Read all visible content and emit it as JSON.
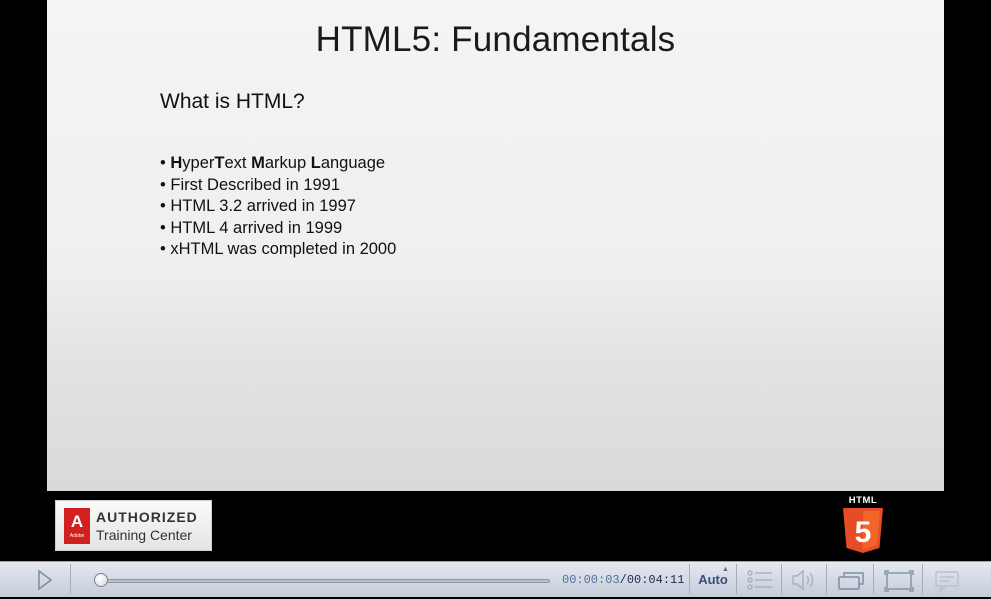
{
  "slide": {
    "title": "HTML5: Fundamentals",
    "subtitle": "What is HTML?",
    "bullets": [
      {
        "b1": "H",
        "t1": "yper",
        "b2": "T",
        "t2": "ext ",
        "b3": "M",
        "t3": "arkup ",
        "b4": "L",
        "t4": "anguage"
      },
      {
        "text": "First Described in 1991"
      },
      {
        "text": "HTML 3.2 arrived in 1997"
      },
      {
        "text": "HTML 4 arrived in 1999"
      },
      {
        "text": "xHTML was completed in 2000"
      }
    ],
    "bullet_char": "•"
  },
  "badge": {
    "logo_letter": "A",
    "logo_small": "Adobe",
    "line1": "AUTHORIZED",
    "line2": "Training Center",
    "accent": "#d21f1f"
  },
  "html5_badge": {
    "label": "HTML",
    "number": "5",
    "accent": "#e44d26"
  },
  "player": {
    "current_time": "00:00:03",
    "separator": "/",
    "total_time": "00:04:11",
    "progress_fraction": 0.012,
    "quality": "Auto",
    "icons": [
      "play-icon",
      "chapters-icon",
      "volume-icon",
      "popout-icon",
      "fullscreen-icon",
      "captions-icon"
    ]
  }
}
